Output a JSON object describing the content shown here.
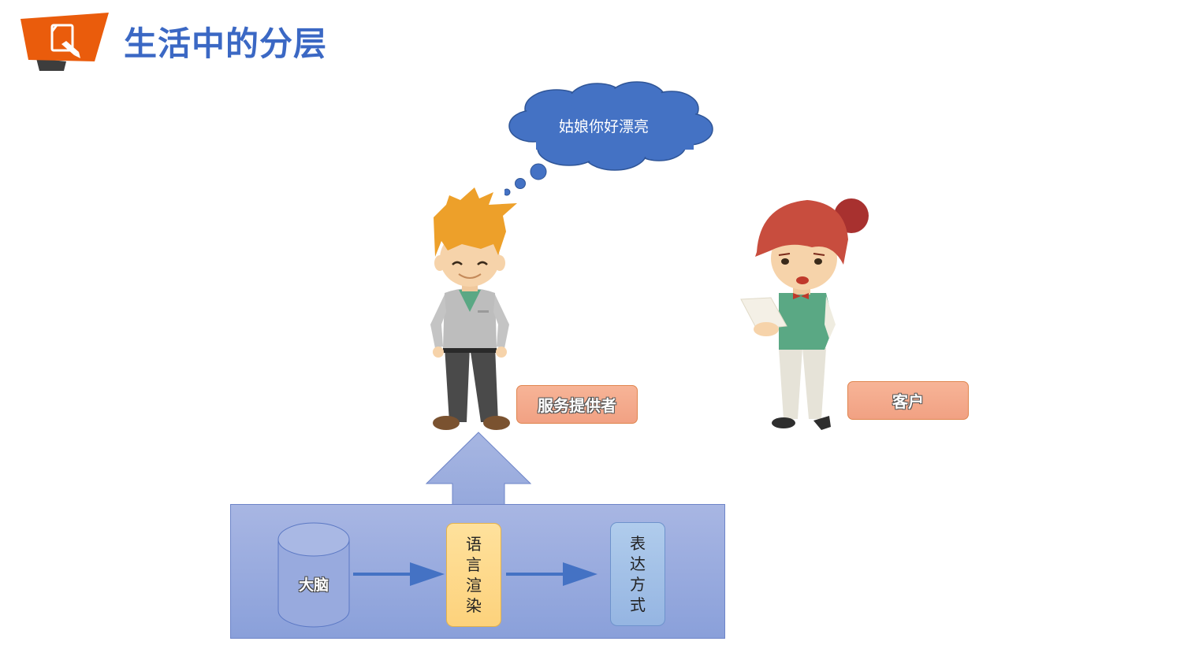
{
  "header": {
    "title": "生活中的分层"
  },
  "thought": {
    "text": "姑娘你好漂亮"
  },
  "labels": {
    "provider": "服务提供者",
    "customer": "客户"
  },
  "flow": {
    "brain": "大脑",
    "render": [
      "语",
      "言",
      "渲",
      "染"
    ],
    "expression": [
      "表",
      "达",
      "方",
      "式"
    ]
  }
}
